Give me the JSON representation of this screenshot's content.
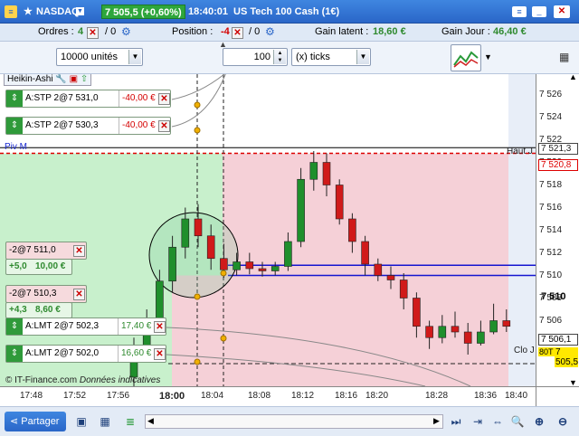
{
  "title": {
    "symbol": "NASDAQ",
    "price_badge": "7 505,5 (+0,60%)",
    "time": "18:40:01",
    "instrument": "US Tech 100 Cash (1€)"
  },
  "status": {
    "orders_label": "Ordres :",
    "orders_a": "4",
    "orders_b": "/ 0",
    "position_label": "Position :",
    "position_a": "-4",
    "position_b": "/ 0",
    "gain_latent_label": "Gain latent :",
    "gain_latent_value": "18,60 €",
    "gain_jour_label": "Gain Jour :",
    "gain_jour_value": "46,40 €"
  },
  "toolbar": {
    "units": "10000 unités",
    "ticks_value": "100",
    "ticks_unit": "(x) ticks"
  },
  "chart": {
    "indicator": "Heikin-Ashi",
    "piv": "Piv M",
    "haut": "Haut J",
    "clo": "Clo J",
    "watermark": "© IT-Finance.com",
    "watermark_italic": "Données indicatives"
  },
  "orders": [
    {
      "label": "A:STP  2@7 531,0",
      "value": "-40,00 €"
    },
    {
      "label": "A:STP  2@7 530,3",
      "value": "-40,00 €"
    },
    {
      "label": "-2@7 511,0",
      "gain_a": "+5,0",
      "gain_b": "10,00 €"
    },
    {
      "label": "-2@7 510,3",
      "gain_a": "+4,3",
      "gain_b": "8,60 €"
    },
    {
      "label": "A:LMT  2@7 502,3",
      "value": "17,40 €"
    },
    {
      "label": "A:LMT  2@7 502,0",
      "value": "16,60 €"
    }
  ],
  "price_ticks": [
    "7 526",
    "7 524",
    "7 522",
    "7 520",
    "7 518",
    "7 516",
    "7 514",
    "7 512",
    "7 510",
    "7 508",
    "7 506"
  ],
  "price_labels": {
    "p1": "7 521,3",
    "p2": "7 520,8",
    "current": "7 510",
    "ask": "7 506,1",
    "bid": "7 505,5",
    "tag": "80T"
  },
  "time_ticks": [
    "17:48",
    "17:52",
    "17:56",
    "18:00",
    "18:04",
    "18:08",
    "18:12",
    "18:16",
    "18:20",
    "18:28",
    "18:36",
    "18:40"
  ],
  "bottom": {
    "share": "Partager"
  },
  "candles": [
    {
      "o": 7501.0,
      "c": 7503.5,
      "h": 7504.5,
      "l": 7500.0
    },
    {
      "o": 7503.5,
      "c": 7506.0,
      "h": 7507.0,
      "l": 7502.5
    },
    {
      "o": 7506.0,
      "c": 7509.5,
      "h": 7510.5,
      "l": 7505.0
    },
    {
      "o": 7509.5,
      "c": 7512.5,
      "h": 7513.5,
      "l": 7508.5
    },
    {
      "o": 7512.5,
      "c": 7515.0,
      "h": 7516.0,
      "l": 7511.5
    },
    {
      "o": 7515.0,
      "c": 7513.5,
      "h": 7516.3,
      "l": 7512.5
    },
    {
      "o": 7513.5,
      "c": 7511.5,
      "h": 7514.5,
      "l": 7510.5
    },
    {
      "o": 7511.5,
      "c": 7510.5,
      "h": 7512.8,
      "l": 7509.8
    },
    {
      "o": 7510.5,
      "c": 7511.2,
      "h": 7512.0,
      "l": 7510.0
    },
    {
      "o": 7511.2,
      "c": 7510.6,
      "h": 7512.0,
      "l": 7510.1
    },
    {
      "o": 7510.6,
      "c": 7510.4,
      "h": 7511.2,
      "l": 7509.9
    },
    {
      "o": 7510.4,
      "c": 7510.8,
      "h": 7511.2,
      "l": 7510.0
    },
    {
      "o": 7510.8,
      "c": 7513.0,
      "h": 7513.8,
      "l": 7510.4
    },
    {
      "o": 7513.0,
      "c": 7518.5,
      "h": 7519.5,
      "l": 7512.5
    },
    {
      "o": 7518.5,
      "c": 7520.0,
      "h": 7521.0,
      "l": 7517.5
    },
    {
      "o": 7520.0,
      "c": 7518.0,
      "h": 7520.8,
      "l": 7517.0
    },
    {
      "o": 7518.0,
      "c": 7515.0,
      "h": 7518.5,
      "l": 7514.5
    },
    {
      "o": 7515.0,
      "c": 7513.0,
      "h": 7515.5,
      "l": 7512.0
    },
    {
      "o": 7513.0,
      "c": 7511.0,
      "h": 7513.5,
      "l": 7510.0
    },
    {
      "o": 7511.0,
      "c": 7510.0,
      "h": 7511.5,
      "l": 7509.5
    },
    {
      "o": 7510.0,
      "c": 7509.6,
      "h": 7510.8,
      "l": 7508.8
    },
    {
      "o": 7509.6,
      "c": 7508.0,
      "h": 7510.2,
      "l": 7507.0
    },
    {
      "o": 7508.0,
      "c": 7505.5,
      "h": 7508.5,
      "l": 7504.5
    },
    {
      "o": 7505.5,
      "c": 7504.5,
      "h": 7506.0,
      "l": 7503.5
    },
    {
      "o": 7504.5,
      "c": 7505.5,
      "h": 7506.5,
      "l": 7504.0
    },
    {
      "o": 7505.5,
      "c": 7505.0,
      "h": 7506.8,
      "l": 7504.5
    },
    {
      "o": 7505.0,
      "c": 7504.0,
      "h": 7505.8,
      "l": 7503.0
    },
    {
      "o": 7504.0,
      "c": 7505.0,
      "h": 7506.0,
      "l": 7503.8
    },
    {
      "o": 7505.0,
      "c": 7506.0,
      "h": 7507.5,
      "l": 7504.8
    },
    {
      "o": 7506.0,
      "c": 7505.5,
      "h": 7507.0,
      "l": 7505.0
    }
  ],
  "levels": {
    "haut": 7521.3,
    "piv": 7520.8,
    "blue_a": 7510.9,
    "blue_b": 7510.0,
    "dashed": 7502.2
  },
  "colors": {
    "up": "#1f8f2c",
    "down": "#d01a1a",
    "accent": "#2a66c8",
    "zone_green": "#c8f0cc",
    "zone_pink": "#f5d0d7",
    "sell": "#c8202a",
    "buy": "#2f9a3a"
  }
}
